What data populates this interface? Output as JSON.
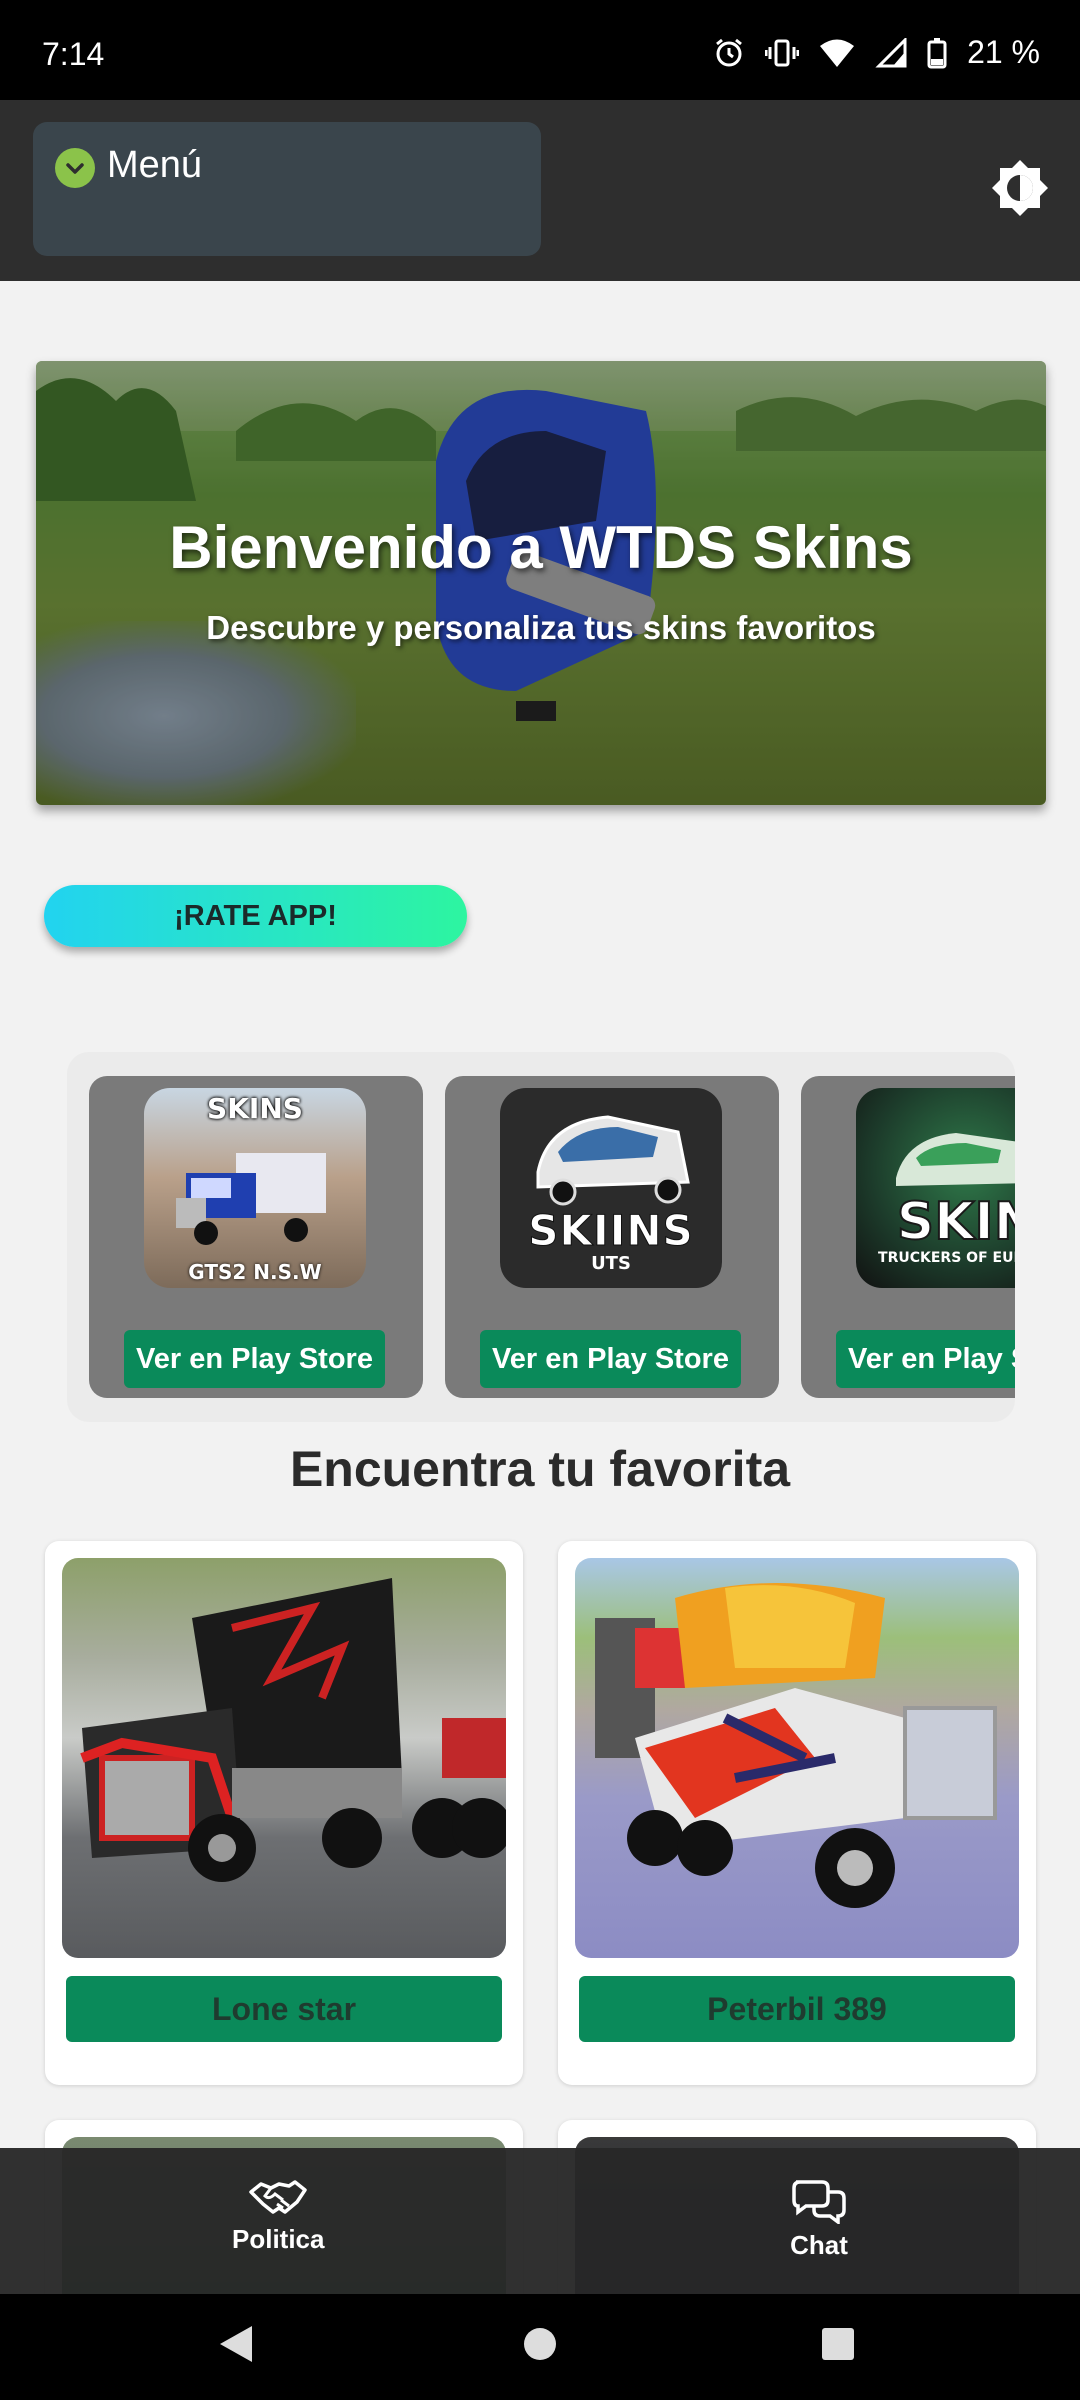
{
  "status_bar": {
    "time": "7:14",
    "battery_percent": "21 %",
    "icons": [
      "alarm-icon",
      "vibrate-icon",
      "wifi-icon",
      "signal-icon",
      "battery-icon"
    ]
  },
  "header": {
    "menu_label": "Menú",
    "theme_icon": "brightness-icon"
  },
  "hero": {
    "title": "Bienvenido a WTDS Skins",
    "subtitle": "Descubre y personaliza tus skins favoritos"
  },
  "rate_button": {
    "label": "¡RATE APP!"
  },
  "apps": [
    {
      "thumb_top": "SKINS",
      "thumb_bottom": "GTS2 N.S.W",
      "button_label": "Ver en Play Store"
    },
    {
      "thumb_top": "SKIINS",
      "thumb_bottom": "UTS",
      "button_label": "Ver en Play Store"
    },
    {
      "thumb_top": "SKIN",
      "thumb_bottom": "TRUCKERS OF EUROPE",
      "button_label": "Ver en Play Store"
    }
  ],
  "section_title": "Encuentra tu favorita",
  "skins": [
    {
      "name": "Lone star"
    },
    {
      "name": "Peterbil 389"
    }
  ],
  "bottom_nav": {
    "politica_label": "Politica",
    "chat_label": "Chat"
  },
  "colors": {
    "accent_green": "#0a8a5a",
    "header_bg": "#2e2e2e",
    "menu_bg": "#3a454c",
    "check_green": "#8bc34a"
  }
}
